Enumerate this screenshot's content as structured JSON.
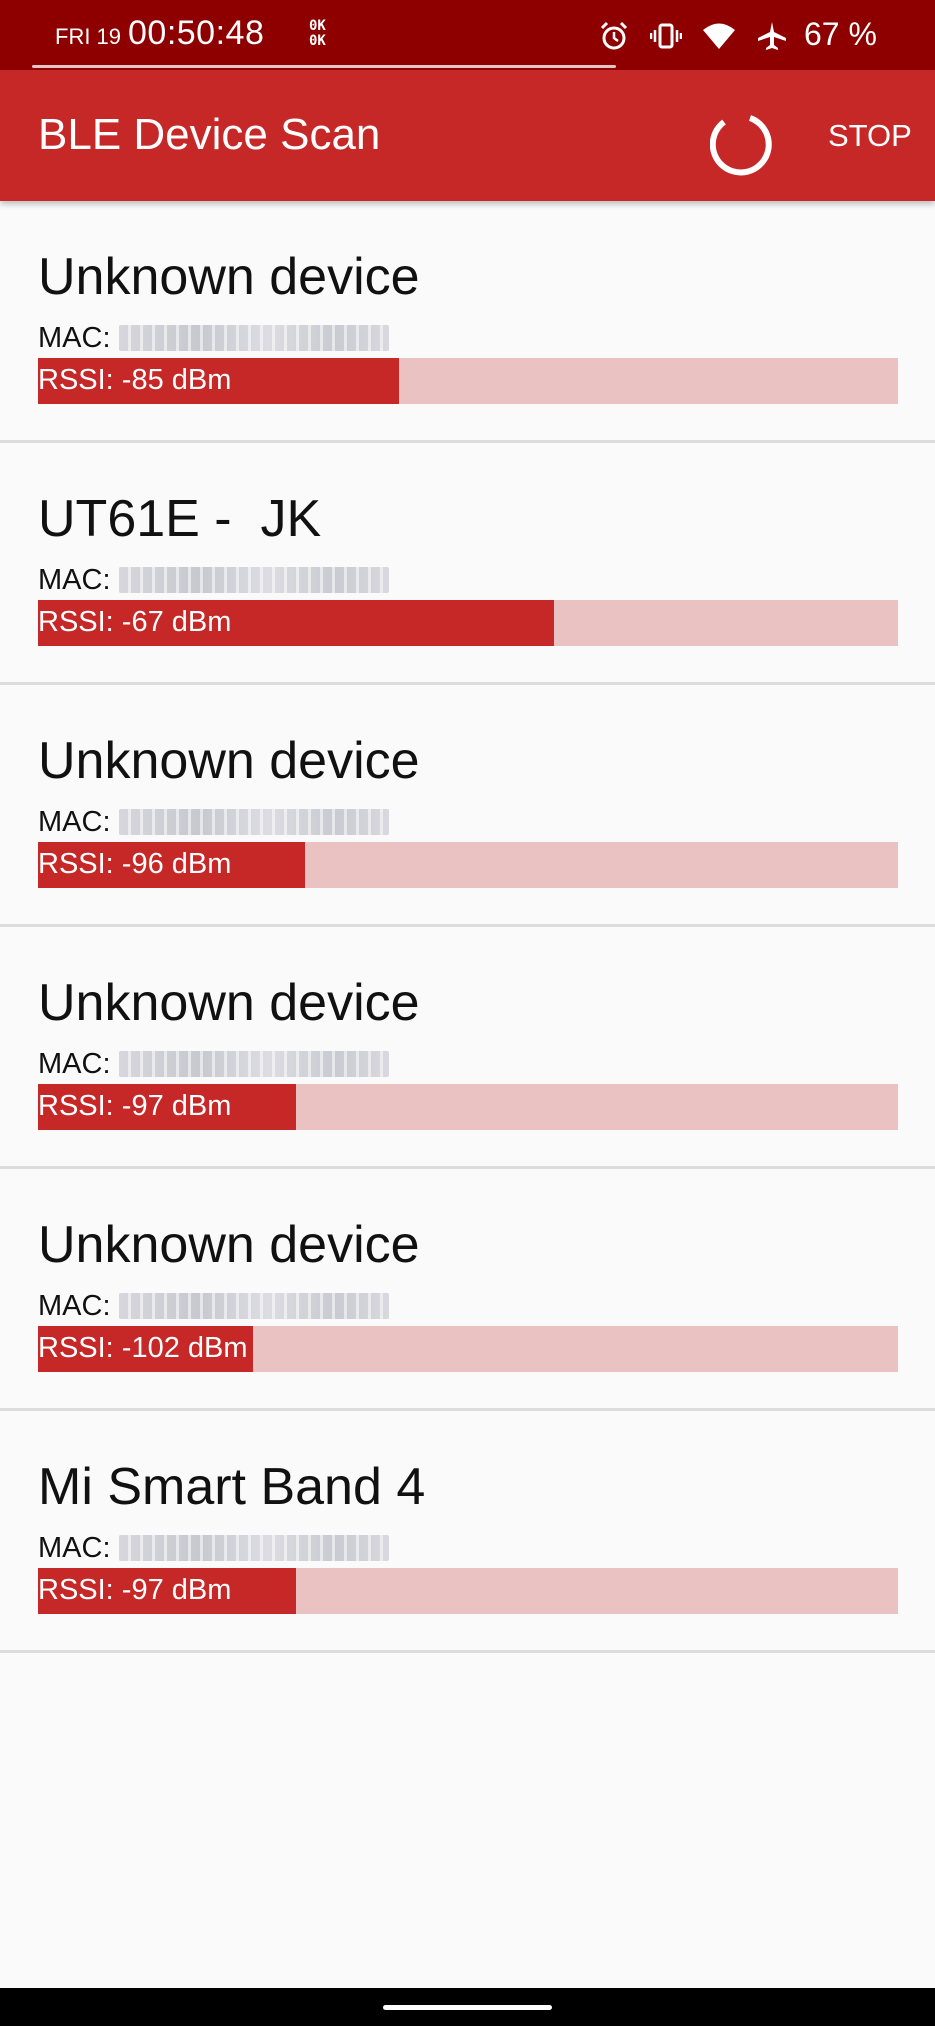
{
  "status_bar": {
    "date": "FRI 19",
    "time": "00:50:48",
    "ok_badge": "0K\n0K",
    "battery": "67 %",
    "icons": [
      "alarm-icon",
      "vibrate-icon",
      "wifi-icon",
      "airplane-icon"
    ]
  },
  "app_bar": {
    "title": "BLE Device Scan",
    "stop_label": "STOP",
    "color": "#c62828"
  },
  "devices": [
    {
      "name": "Unknown device",
      "mac_label": "MAC:",
      "mac_value": "redacted",
      "rssi_label": "RSSI: -85 dBm",
      "rssi_fraction": 0.42
    },
    {
      "name": "UT61E -  JK",
      "mac_label": "MAC:",
      "mac_value": "redacted",
      "rssi_label": "RSSI: -67 dBm",
      "rssi_fraction": 0.6
    },
    {
      "name": "Unknown device",
      "mac_label": "MAC:",
      "mac_value": "redacted",
      "rssi_label": "RSSI: -96 dBm",
      "rssi_fraction": 0.31
    },
    {
      "name": "Unknown device",
      "mac_label": "MAC:",
      "mac_value": "redacted",
      "rssi_label": "RSSI: -97 dBm",
      "rssi_fraction": 0.3
    },
    {
      "name": "Unknown device",
      "mac_label": "MAC:",
      "mac_value": "redacted",
      "rssi_label": "RSSI: -102 dBm",
      "rssi_fraction": 0.25
    },
    {
      "name": "Mi Smart Band 4",
      "mac_label": "MAC:",
      "mac_value": "redacted",
      "rssi_label": "RSSI: -97 dBm",
      "rssi_fraction": 0.3
    }
  ]
}
